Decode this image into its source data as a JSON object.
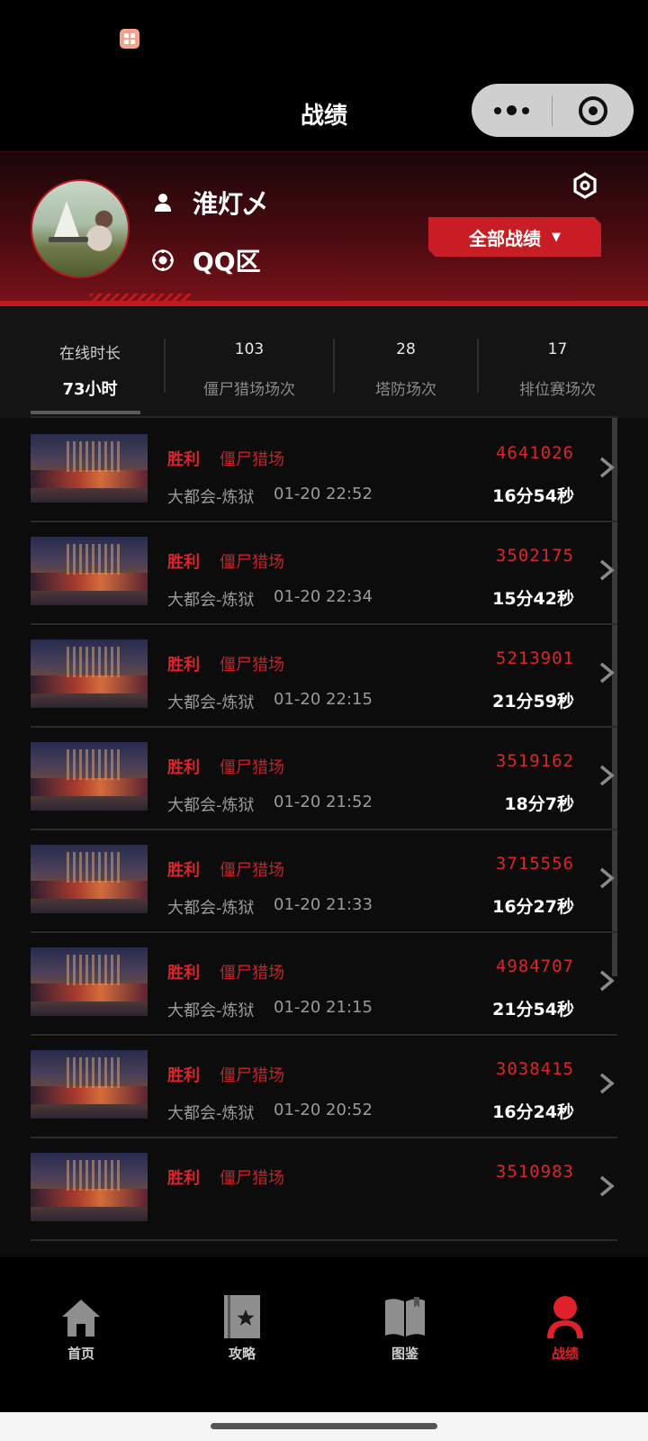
{
  "nav": {
    "title": "战绩"
  },
  "profile": {
    "name": "淮灯乄",
    "zone": "QQ区",
    "filter_label": "全部战绩",
    "filter_caret": "▼"
  },
  "stats": [
    {
      "value": "在线时长",
      "label": "73小时"
    },
    {
      "value": "103",
      "label": "僵尸猎场场次"
    },
    {
      "value": "28",
      "label": "塔防场次"
    },
    {
      "value": "17",
      "label": "排位赛场次"
    }
  ],
  "records": [
    {
      "result": "胜利",
      "mode": "僵尸猎场",
      "map": "大都会-炼狱",
      "time": "01-20 22:52",
      "score": "4641026",
      "duration": "16分54秒"
    },
    {
      "result": "胜利",
      "mode": "僵尸猎场",
      "map": "大都会-炼狱",
      "time": "01-20 22:34",
      "score": "3502175",
      "duration": "15分42秒"
    },
    {
      "result": "胜利",
      "mode": "僵尸猎场",
      "map": "大都会-炼狱",
      "time": "01-20 22:15",
      "score": "5213901",
      "duration": "21分59秒"
    },
    {
      "result": "胜利",
      "mode": "僵尸猎场",
      "map": "大都会-炼狱",
      "time": "01-20 21:52",
      "score": "3519162",
      "duration": "18分7秒"
    },
    {
      "result": "胜利",
      "mode": "僵尸猎场",
      "map": "大都会-炼狱",
      "time": "01-20 21:33",
      "score": "3715556",
      "duration": "16分27秒"
    },
    {
      "result": "胜利",
      "mode": "僵尸猎场",
      "map": "大都会-炼狱",
      "time": "01-20 21:15",
      "score": "4984707",
      "duration": "21分54秒"
    },
    {
      "result": "胜利",
      "mode": "僵尸猎场",
      "map": "大都会-炼狱",
      "time": "01-20 20:52",
      "score": "3038415",
      "duration": "16分24秒"
    },
    {
      "result": "胜利",
      "mode": "僵尸猎场",
      "map": "",
      "time": "",
      "score": "3510983",
      "duration": ""
    }
  ],
  "tabs": [
    {
      "label": "首页",
      "icon": "home-icon"
    },
    {
      "label": "攻略",
      "icon": "guide-book-icon"
    },
    {
      "label": "图鉴",
      "icon": "open-book-icon"
    },
    {
      "label": "战绩",
      "icon": "user-icon"
    }
  ],
  "colors": {
    "accent": "#d9262d",
    "header_red": "#7a121a",
    "background": "#0c0c0c"
  }
}
